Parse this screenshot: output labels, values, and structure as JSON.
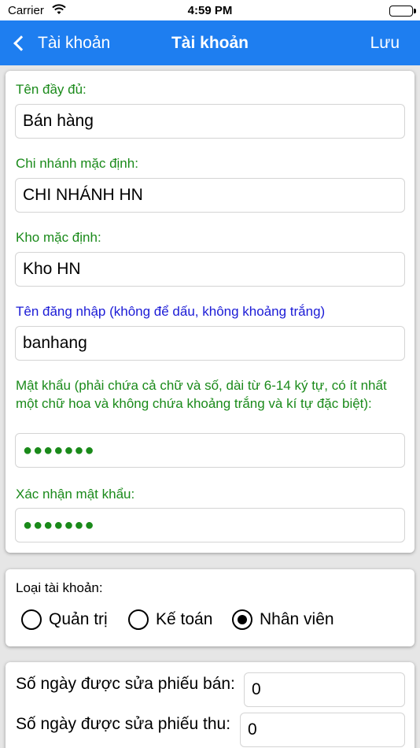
{
  "status_bar": {
    "carrier": "Carrier",
    "time": "4:59 PM"
  },
  "nav": {
    "back_label": "Tài khoản",
    "title": "Tài khoản",
    "save_label": "Lưu"
  },
  "form": {
    "full_name": {
      "label": "Tên đầy đủ:",
      "value": "Bán hàng"
    },
    "default_branch": {
      "label": "Chi nhánh mặc định:",
      "value": "CHI NHÁNH HN"
    },
    "default_warehouse": {
      "label": "Kho mặc định:",
      "value": "Kho HN"
    },
    "username": {
      "label": "Tên đăng nhập (không để dấu, không khoảng trắng)",
      "value": "banhang",
      "label_color": "#1b1bd6"
    },
    "password": {
      "label": "Mật khẩu (phải chứa cả chữ và số, dài từ 6-14 ký tự, có ít nhất một chữ hoa và không chứa khoảng trắng và kí tự đặc biệt):",
      "value": "●●●●●●●"
    },
    "confirm_password": {
      "label": "Xác nhận mật khẩu:",
      "value": "●●●●●●●"
    }
  },
  "account_type": {
    "label": "Loại tài khoản:",
    "options": [
      {
        "label": "Quản trị",
        "selected": false
      },
      {
        "label": "Kế toán",
        "selected": false
      },
      {
        "label": "Nhân viên",
        "selected": true
      }
    ]
  },
  "edit_days": {
    "sales_receipt": {
      "label": "Số ngày được sửa phiếu bán:",
      "value": "0"
    },
    "payment_receipt": {
      "label": "Số ngày được sửa phiếu thu:",
      "value": "0"
    }
  },
  "colors": {
    "nav_bg": "#1e7ef0",
    "label_green": "#1a8a1a",
    "label_blue": "#1b1bd6",
    "background": "#e6e6e6"
  },
  "icons": {
    "back": "chevron-left-icon",
    "wifi": "wifi-icon",
    "battery": "battery-icon"
  }
}
